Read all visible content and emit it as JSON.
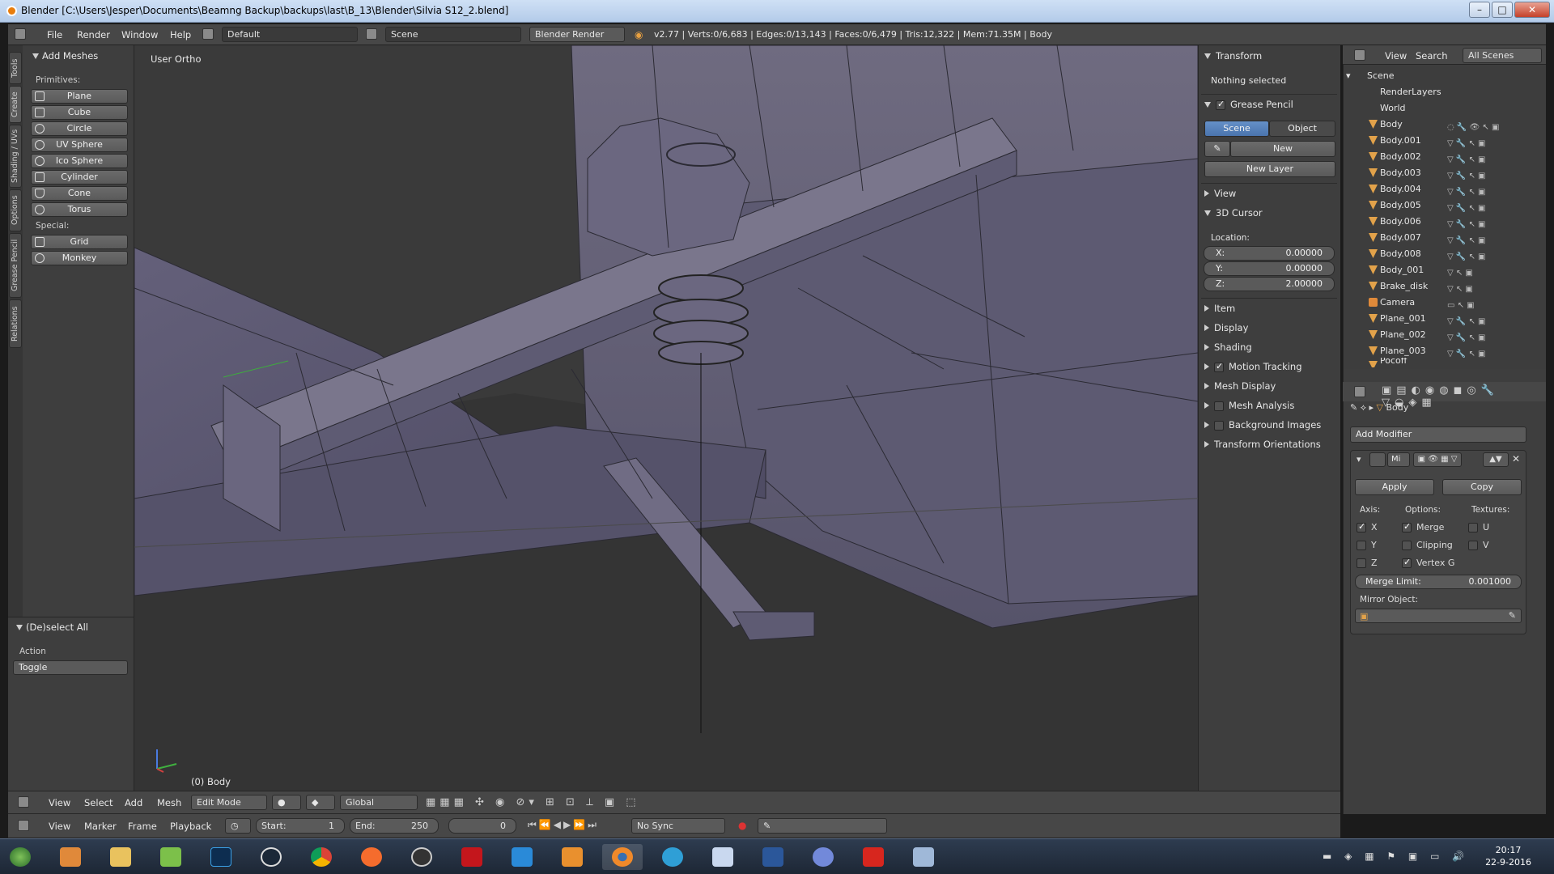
{
  "window": {
    "title": "Blender [C:\\Users\\Jesper\\Documents\\Beamng Backup\\backups\\last\\B_13\\Blender\\Silvia S12_2.blend]"
  },
  "infobar": {
    "menus": [
      "File",
      "Render",
      "Window",
      "Help"
    ],
    "layout": "Default",
    "scene": "Scene",
    "engine": "Blender Render",
    "stats": "v2.77 | Verts:0/6,683 | Edges:0/13,143 | Faces:0/6,479 | Tris:12,322 | Mem:71.35M | Body"
  },
  "toolshelf": {
    "tabs": [
      "Tools",
      "Create",
      "Shading / UVs",
      "Options",
      "Grease Pencil",
      "Relations"
    ],
    "panel_title": "Add Meshes",
    "primitives_label": "Primitives:",
    "primitives": [
      "Plane",
      "Cube",
      "Circle",
      "UV Sphere",
      "Ico Sphere",
      "Cylinder",
      "Cone",
      "Torus"
    ],
    "special_label": "Special:",
    "special": [
      "Grid",
      "Monkey"
    ]
  },
  "last_operator": {
    "title": "(De)select All",
    "action_label": "Action",
    "action_value": "Toggle"
  },
  "viewport": {
    "view_name": "User Ortho",
    "object_label": "(0) Body"
  },
  "npanel": {
    "transform": "Transform",
    "nothing_selected": "Nothing selected",
    "grease_pencil": "Grease Pencil",
    "scene_btn": "Scene",
    "object_btn": "Object",
    "new_btn": "New",
    "new_layer_btn": "New Layer",
    "view": "View",
    "cursor_title": "3D Cursor",
    "location_label": "Location:",
    "cursor": {
      "x_label": "X:",
      "x": "0.00000",
      "y_label": "Y:",
      "y": "0.00000",
      "z_label": "Z:",
      "z": "2.00000"
    },
    "sections": [
      "Item",
      "Display",
      "Shading",
      "Motion Tracking",
      "Mesh Display",
      "Mesh Analysis",
      "Background Images",
      "Transform Orientations"
    ]
  },
  "outliner": {
    "menus": [
      "View",
      "Search"
    ],
    "filter": "All Scenes",
    "scene": "Scene",
    "renderlayers": "RenderLayers",
    "world": "World",
    "objects": [
      "Body",
      "Body.001",
      "Body.002",
      "Body.003",
      "Body.004",
      "Body.005",
      "Body.006",
      "Body.007",
      "Body.008",
      "Body_001",
      "Brake_disk",
      "Camera",
      "Plane_001",
      "Plane_002",
      "Plane_003",
      "Pocoff"
    ]
  },
  "properties": {
    "breadcrumb": "Body",
    "add_modifier": "Add Modifier",
    "modifier_name": "Mi",
    "apply": "Apply",
    "copy": "Copy",
    "axis_label": "Axis:",
    "options_label": "Options:",
    "textures_label": "Textures:",
    "axis": [
      "X",
      "Y",
      "Z"
    ],
    "options": [
      "Merge",
      "Clipping",
      "Vertex G"
    ],
    "textures": [
      "U",
      "V"
    ],
    "merge_limit_label": "Merge Limit:",
    "merge_limit": "0.001000",
    "mirror_object_label": "Mirror Object:"
  },
  "viewport_header": {
    "menus": [
      "View",
      "Select",
      "Add",
      "Mesh"
    ],
    "mode": "Edit Mode",
    "orientation": "Global"
  },
  "timeline": {
    "menus": [
      "View",
      "Marker",
      "Frame",
      "Playback"
    ],
    "start_label": "Start:",
    "start": "1",
    "end_label": "End:",
    "end": "250",
    "current": "0",
    "sync": "No Sync"
  },
  "taskbar": {
    "time": "20:17",
    "date": "22-9-2016"
  }
}
